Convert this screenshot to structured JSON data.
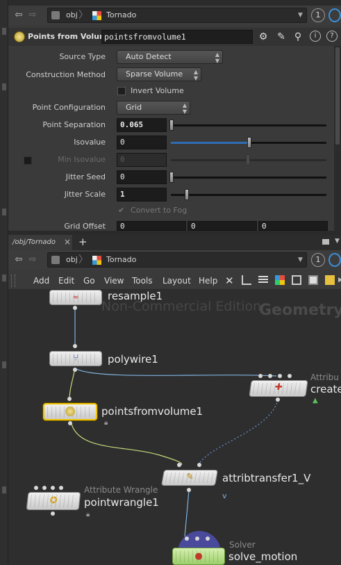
{
  "parameter_pane": {
    "pathbar": {
      "network": "obj",
      "object": "Tornado",
      "pin_label": "1"
    },
    "header": {
      "node_type": "Points from Volume",
      "node_name": "pointsfromvolume1",
      "icons": [
        "gear-icon",
        "brush-icon",
        "search-icon",
        "info-icon",
        "help-icon"
      ]
    },
    "params": {
      "source_type": {
        "label": "Source Type",
        "value": "Auto Detect"
      },
      "construction_method": {
        "label": "Construction Method",
        "value": "Sparse Volume"
      },
      "invert_volume": {
        "label": "Invert Volume",
        "checked": false
      },
      "point_configuration": {
        "label": "Point Configuration",
        "value": "Grid"
      },
      "point_separation": {
        "label": "Point Separation",
        "value": "0.065",
        "slider_fraction": 0.0
      },
      "isovalue": {
        "label": "Isovalue",
        "value": "0",
        "slider_fraction": 0.5
      },
      "min_isovalue": {
        "label": "Min Isovalue",
        "value": "0",
        "enabled": false
      },
      "jitter_seed": {
        "label": "Jitter Seed",
        "value": "0",
        "slider_fraction": 0.0
      },
      "jitter_scale": {
        "label": "Jitter Scale",
        "value": "1",
        "slider_fraction": 0.1
      },
      "convert_to_fog": {
        "label": "Convert to Fog",
        "enabled": false
      },
      "grid_offset": {
        "label": "Grid Offset",
        "values": [
          "0",
          "0",
          "0"
        ]
      }
    }
  },
  "network_pane": {
    "tab": {
      "label": "/obj/Tornado",
      "close": "×",
      "add": "+"
    },
    "pathbar": {
      "network": "obj",
      "object": "Tornado",
      "pin_label": "1"
    },
    "menu": [
      "Add",
      "Edit",
      "Go",
      "View",
      "Tools",
      "Layout",
      "Help"
    ],
    "watermark": "Non-Commercial Edition",
    "context_label": "Geometry",
    "nodes": {
      "resample": {
        "name": "resample1"
      },
      "polywire": {
        "name": "polywire1"
      },
      "pointsfromvolume": {
        "name": "pointsfromvolume1"
      },
      "create": {
        "type": "Attribu",
        "name": "create"
      },
      "attribtransfer": {
        "name": "attribtransfer1_V",
        "flag": "v"
      },
      "pointwrangle": {
        "type": "Attribute Wrangle",
        "name": "pointwrangle1"
      },
      "solver": {
        "type": "Solver",
        "name": "solve_motion"
      }
    }
  },
  "colors": {
    "selected_outline": "#f2c300",
    "slider_fill": "#2f6db2",
    "wire": "#7fb3e0",
    "wire_green": "#c3dc7a",
    "wire_dotted": "#6b8fd8"
  }
}
